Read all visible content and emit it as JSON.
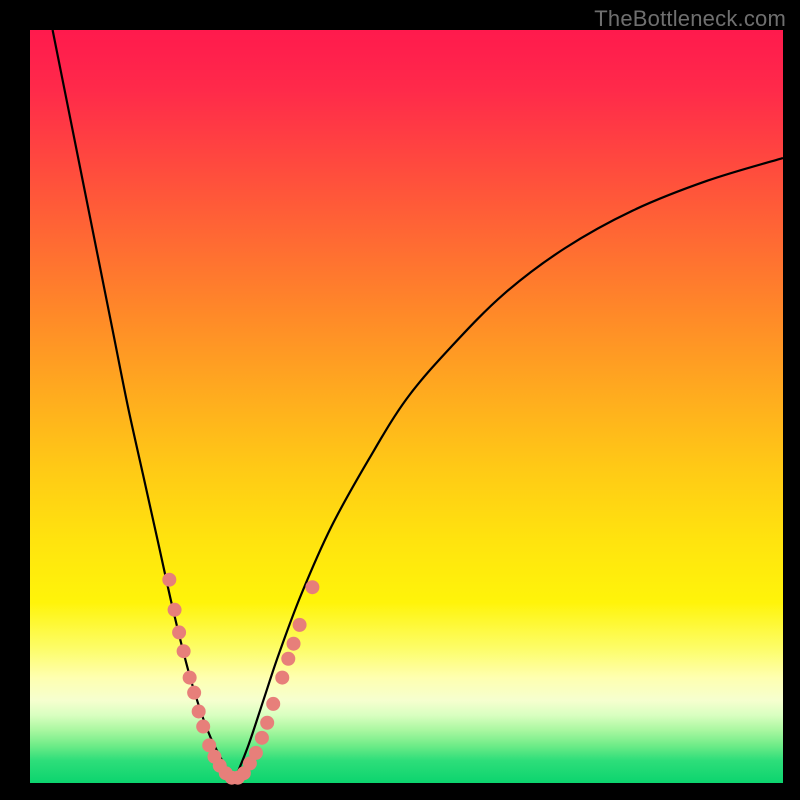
{
  "watermark": "TheBottleneck.com",
  "colors": {
    "frame_bg": "#000000",
    "curve_stroke": "#000000",
    "marker_fill": "#e77f7a",
    "marker_stroke": "#d96a65"
  },
  "chart_data": {
    "type": "line",
    "title": "",
    "xlabel": "",
    "ylabel": "",
    "xlim": [
      0,
      100
    ],
    "ylim": [
      0,
      100
    ],
    "series": [
      {
        "name": "left-branch",
        "x": [
          3,
          5,
          7,
          9,
          11,
          13,
          15,
          17,
          19,
          21,
          22.5,
          24,
          25.5,
          27
        ],
        "y": [
          100,
          90,
          80,
          70,
          60,
          50,
          41,
          32,
          23,
          15,
          10,
          6,
          3,
          0
        ]
      },
      {
        "name": "right-branch",
        "x": [
          27,
          29,
          31,
          33,
          36,
          40,
          45,
          50,
          56,
          63,
          71,
          80,
          90,
          100
        ],
        "y": [
          0,
          5,
          11,
          17,
          25,
          34,
          43,
          51,
          58,
          65,
          71,
          76,
          80,
          83
        ]
      }
    ],
    "markers": [
      {
        "x": 18.5,
        "y": 27
      },
      {
        "x": 19.2,
        "y": 23
      },
      {
        "x": 19.8,
        "y": 20
      },
      {
        "x": 20.4,
        "y": 17.5
      },
      {
        "x": 21.2,
        "y": 14
      },
      {
        "x": 21.8,
        "y": 12
      },
      {
        "x": 22.4,
        "y": 9.5
      },
      {
        "x": 23.0,
        "y": 7.5
      },
      {
        "x": 23.8,
        "y": 5
      },
      {
        "x": 24.5,
        "y": 3.5
      },
      {
        "x": 25.2,
        "y": 2.3
      },
      {
        "x": 26.0,
        "y": 1.3
      },
      {
        "x": 26.8,
        "y": 0.7
      },
      {
        "x": 27.6,
        "y": 0.7
      },
      {
        "x": 28.4,
        "y": 1.3
      },
      {
        "x": 29.2,
        "y": 2.6
      },
      {
        "x": 30.0,
        "y": 4
      },
      {
        "x": 30.8,
        "y": 6
      },
      {
        "x": 31.5,
        "y": 8
      },
      {
        "x": 32.3,
        "y": 10.5
      },
      {
        "x": 33.5,
        "y": 14
      },
      {
        "x": 34.3,
        "y": 16.5
      },
      {
        "x": 35.0,
        "y": 18.5
      },
      {
        "x": 35.8,
        "y": 21
      },
      {
        "x": 37.5,
        "y": 26
      }
    ]
  }
}
